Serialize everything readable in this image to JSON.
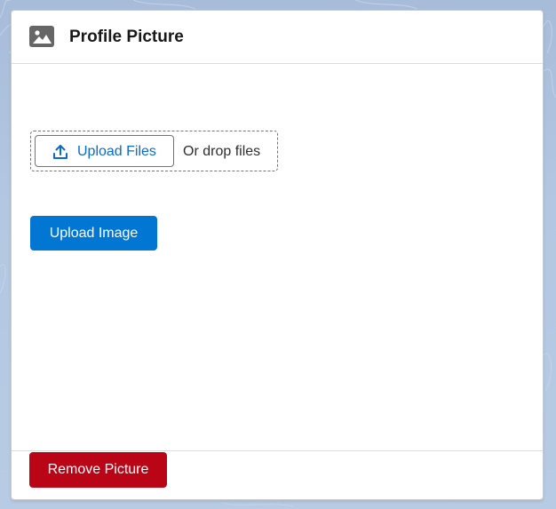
{
  "modal": {
    "title": "Profile Picture",
    "header_icon": "image-icon"
  },
  "upload": {
    "button_label": "Upload Files",
    "button_icon": "upload-icon",
    "drop_text": "Or drop files"
  },
  "actions": {
    "upload_image_label": "Upload Image",
    "remove_picture_label": "Remove Picture"
  },
  "colors": {
    "brand_blue": "#0176d3",
    "destructive_red": "#ba0517",
    "link_blue": "#0b6bcb",
    "header_icon_gray": "#666666"
  }
}
